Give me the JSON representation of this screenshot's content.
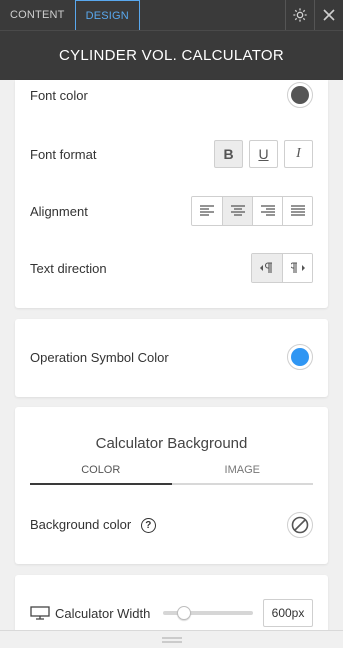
{
  "tabs": [
    {
      "label": "CONTENT",
      "active": false
    },
    {
      "label": "DESIGN",
      "active": true
    }
  ],
  "header": {
    "title": "CYLINDER VOL. CALCULATOR"
  },
  "text_settings": {
    "font_color_label": "Font color",
    "font_color_value": "#555555",
    "font_format_label": "Font format",
    "font_format_buttons": [
      "B",
      "U",
      "I"
    ],
    "alignment_label": "Alignment",
    "alignment_options": [
      "align-left",
      "align-center",
      "align-right",
      "justify"
    ],
    "alignment_selected": "align-center",
    "text_direction_label": "Text direction",
    "text_direction_options": [
      "ltr",
      "rtl"
    ],
    "text_direction_selected": "ltr"
  },
  "operation": {
    "label": "Operation Symbol Color",
    "color": "#2f96f3"
  },
  "background": {
    "title": "Calculator Background",
    "subtabs": [
      "COLOR",
      "IMAGE"
    ],
    "active_subtab": "COLOR",
    "bg_color_label": "Background color",
    "help_glyph": "?"
  },
  "width": {
    "label": "Calculator Width",
    "value": "600px",
    "slider_fraction": 0.23
  },
  "colors": {
    "dark_bar": "#3a3a3a",
    "accent": "#59a8ee"
  }
}
